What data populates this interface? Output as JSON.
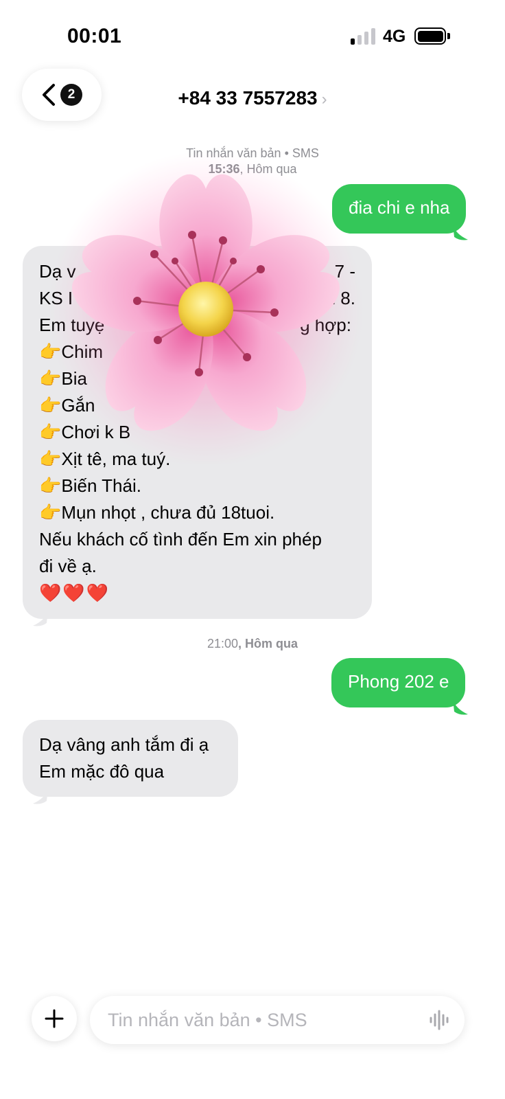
{
  "status_bar": {
    "time": "00:01",
    "network": "4G",
    "signal_bars_active": 1,
    "battery_level": 1.0
  },
  "header": {
    "back_badge_count": "2",
    "contact_number": "+84 33 7557283"
  },
  "thread": {
    "meta_1": {
      "service": "Tin nhắn văn bản • SMS",
      "time": "15:36",
      "day": ", Hôm qua"
    },
    "msg_out_1": "đia chi e nha",
    "msg_in_1": {
      "lines": [
        "Dạ v",
        "7 -",
        "KS I",
        "n 8.",
        "Em tuyệ",
        "g hợp:",
        "👉Chim",
        "👉Bia",
        "👉Gắn",
        "👉Chơi k B",
        "👉Xịt tê, ma tuý.",
        "👉Biến Thái.",
        "👉Mụn nhọt , chưa đủ 18tuoi.",
        "Nếu khách cố tình đến Em xin phép",
        "đi về ạ.",
        "❤️❤️❤️"
      ]
    },
    "meta_2": {
      "time": "21:00",
      "day": ", Hôm qua"
    },
    "msg_out_2": "Phong 202 e",
    "msg_in_2": {
      "lines": [
        "Dạ vâng anh tắm đi ạ",
        "Em mặc đô qua"
      ]
    }
  },
  "composer": {
    "placeholder": "Tin nhắn văn bản • SMS",
    "plus_icon": "plus-icon",
    "audio_icon": "waveform-icon"
  },
  "colors": {
    "outgoing_bubble": "#34c759",
    "incoming_bubble": "#e9e9eb",
    "meta_text": "#8e8e93"
  }
}
